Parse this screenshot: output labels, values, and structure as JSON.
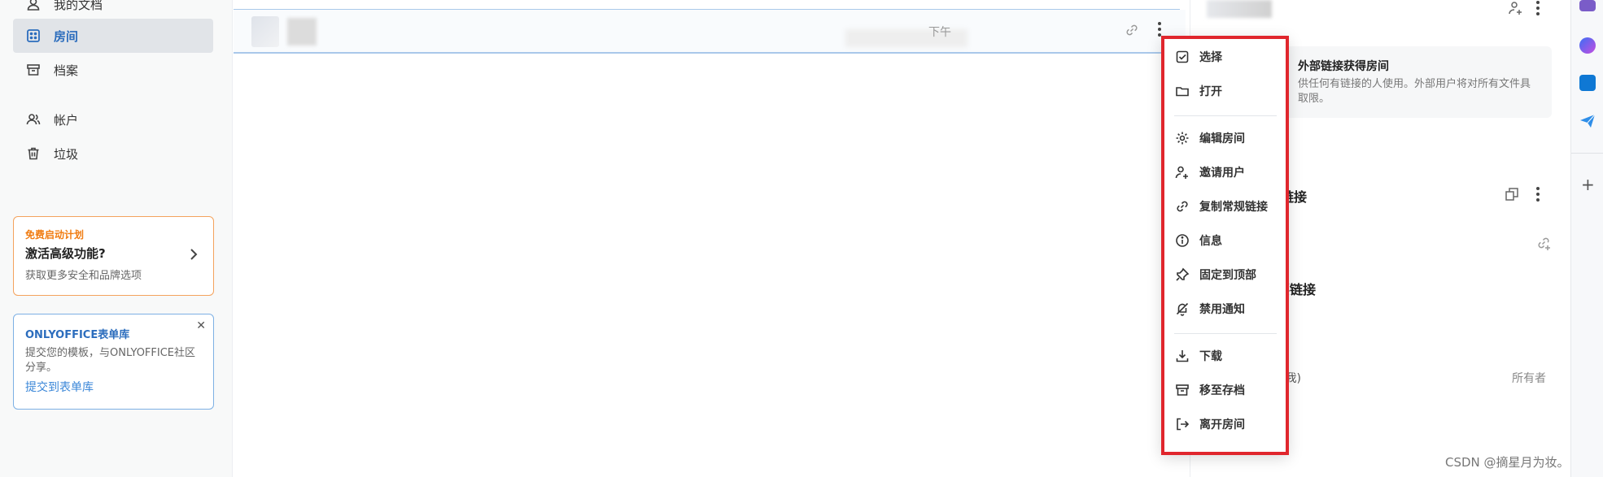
{
  "sidebar": {
    "items": [
      {
        "label": "我的文档",
        "icon": "person-doc-icon"
      },
      {
        "label": "房间",
        "icon": "rooms-icon"
      },
      {
        "label": "档案",
        "icon": "archive-icon"
      },
      {
        "label": "帐户",
        "icon": "accounts-icon"
      },
      {
        "label": "垃圾",
        "icon": "trash-icon"
      }
    ],
    "promo": {
      "tag": "免费启动计划",
      "title": "激活高级功能?",
      "desc": "获取更多安全和品牌选项"
    },
    "forms": {
      "title": "ONLYOFFICE表单库",
      "desc": "提交您的模板，与ONLYOFFICE社区分享。",
      "link": "提交到表单库"
    }
  },
  "list": {
    "row": {
      "time": "下午"
    }
  },
  "context_menu": {
    "items": [
      {
        "label": "选择",
        "icon": "checkbox-icon"
      },
      {
        "label": "打开",
        "icon": "folder-icon"
      },
      {
        "label": "编辑房间",
        "icon": "gear-icon"
      },
      {
        "label": "邀请用户",
        "icon": "add-user-icon"
      },
      {
        "label": "复制常规链接",
        "icon": "link-icon"
      },
      {
        "label": "信息",
        "icon": "info-icon"
      },
      {
        "label": "固定到顶部",
        "icon": "pin-icon"
      },
      {
        "label": "禁用通知",
        "icon": "bell-off-icon"
      },
      {
        "label": "下载",
        "icon": "download-icon"
      },
      {
        "label": "移至存档",
        "icon": "archive-icon"
      },
      {
        "label": "离开房间",
        "icon": "leave-icon"
      }
    ],
    "highlight_color": "#e0262d"
  },
  "panel": {
    "info_title": "外部链接获得房间",
    "info_desc_1": "供任何有链接的人使用。外部用户将对所有文件具",
    "info_desc_2": "取限。",
    "section_1": "链接",
    "section_2": "要链接",
    "member": "(我)",
    "owner": "所有者"
  },
  "watermark": "CSDN @摘星月为妆。",
  "colors": {
    "accent": "#2c6dbd",
    "promo": "#f07b10",
    "forms_border": "#7db0e4"
  }
}
